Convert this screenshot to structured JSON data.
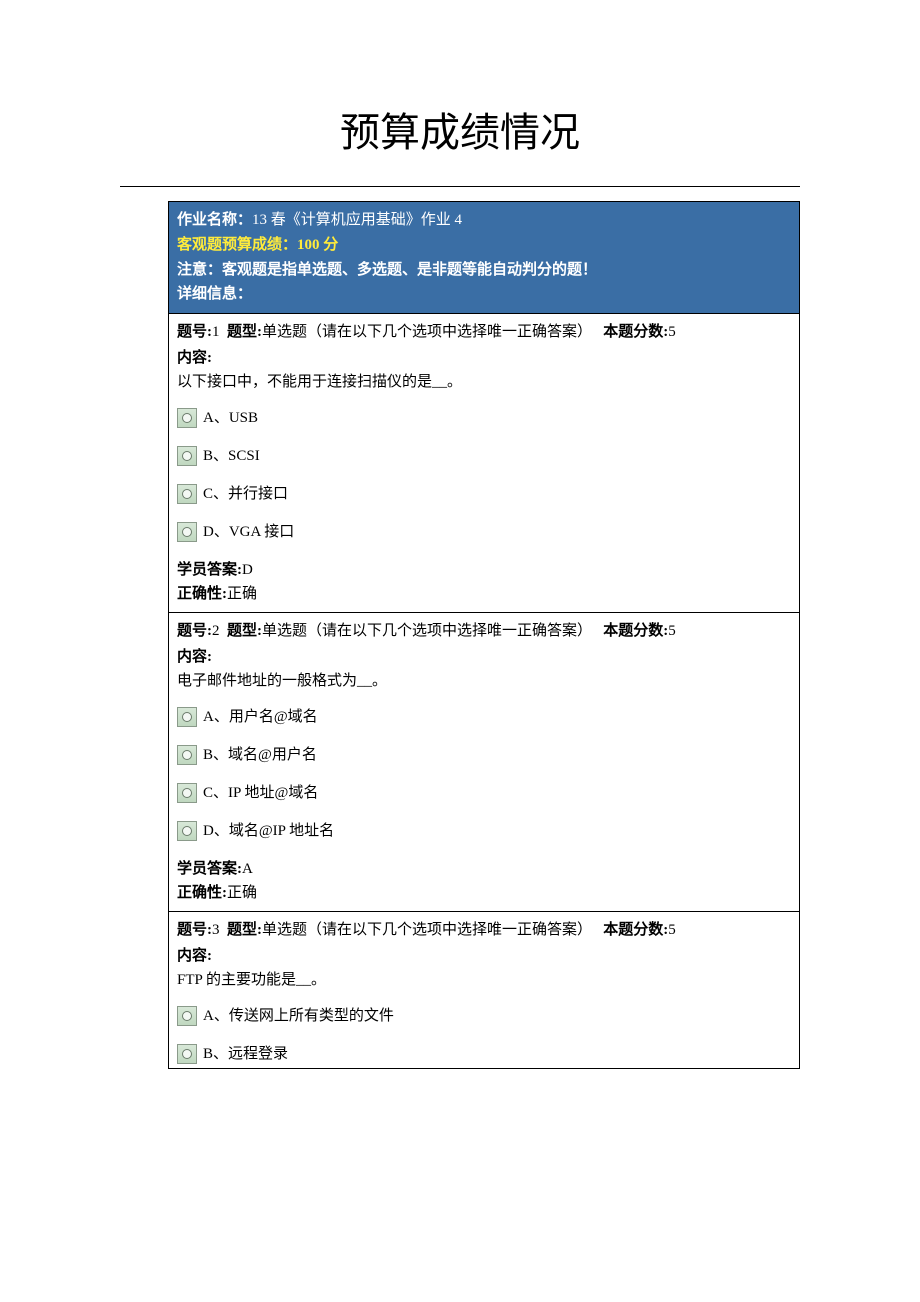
{
  "page_title": "预算成绩情况",
  "header": {
    "work_name_label": "作业名称：",
    "work_name_value": "13 春《计算机应用基础》作业 4",
    "score_line": "客观题预算成绩：100  分",
    "note_line": "注意：客观题是指单选题、多选题、是非题等能自动判分的题！",
    "detail_label": "详细信息："
  },
  "questions": [
    {
      "num_label": "题号:",
      "num": "1",
      "type_label": "题型:",
      "type_text": "单选题（请在以下几个选项中选择唯一正确答案）",
      "score_label": "本题分数:",
      "score": "5",
      "content_label": "内容:",
      "text": "以下接口中，不能用于连接扫描仪的是__。",
      "options": [
        "A、USB",
        "B、SCSI",
        "C、并行接口",
        "D、VGA 接口"
      ],
      "answer_label": "学员答案:",
      "answer": "D",
      "correct_label": "正确性:",
      "correct": "正确"
    },
    {
      "num_label": "题号:",
      "num": "2",
      "type_label": "题型:",
      "type_text": "单选题（请在以下几个选项中选择唯一正确答案）",
      "score_label": "本题分数:",
      "score": "5",
      "content_label": "内容:",
      "text": "电子邮件地址的一般格式为__。",
      "options": [
        "A、用户名@域名",
        "B、域名@用户名",
        "C、IP 地址@域名",
        "D、域名@IP 地址名"
      ],
      "answer_label": "学员答案:",
      "answer": "A",
      "correct_label": "正确性:",
      "correct": "正确"
    },
    {
      "num_label": "题号:",
      "num": "3",
      "type_label": "题型:",
      "type_text": "单选题（请在以下几个选项中选择唯一正确答案）",
      "score_label": "本题分数:",
      "score": "5",
      "content_label": "内容:",
      "text": "FTP 的主要功能是__。",
      "options": [
        "A、传送网上所有类型的文件",
        "B、远程登录"
      ]
    }
  ]
}
